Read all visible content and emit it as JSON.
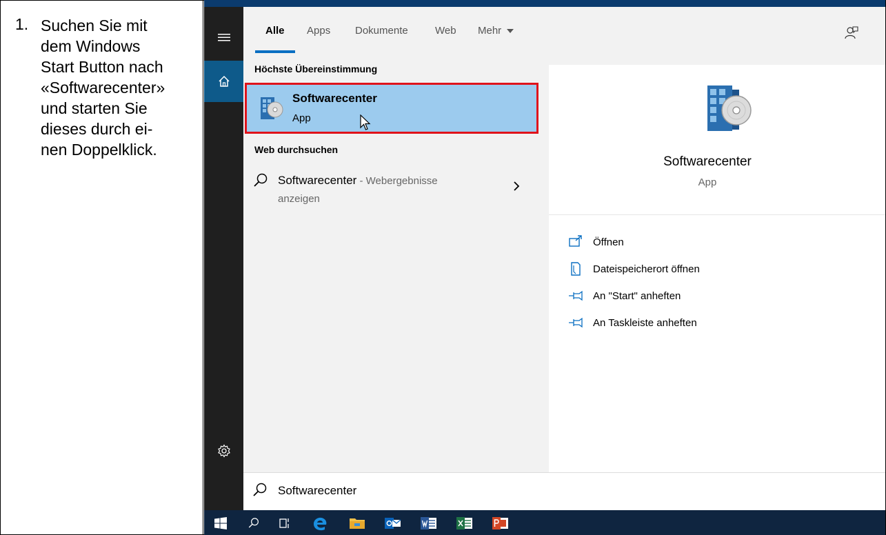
{
  "instruction": {
    "number": "1.",
    "text": "Suchen Sie mit\ndem Windows\nStart Button nach\n«Softwarecenter»\nund starten Sie\ndieses durch ei-\nnen Doppelklick."
  },
  "tabs": [
    {
      "label": "Alle",
      "active": true
    },
    {
      "label": "Apps",
      "active": false
    },
    {
      "label": "Dokumente",
      "active": false
    },
    {
      "label": "Web",
      "active": false
    },
    {
      "label": "Mehr",
      "active": false
    }
  ],
  "results": {
    "best_match_header": "Höchste Übereinstimmung",
    "best_match": {
      "title": "Softwarecenter",
      "subtitle": "App"
    },
    "web_header": "Web durchsuchen",
    "web_result": {
      "term": "Softwarecenter",
      "hint_line1": " - Webergebnisse",
      "hint_line2": "anzeigen"
    }
  },
  "preview": {
    "title": "Softwarecenter",
    "subtitle": "App",
    "actions": [
      {
        "label": "Öffnen",
        "icon": "open-icon"
      },
      {
        "label": "Dateispeicherort öffnen",
        "icon": "file-location-icon"
      },
      {
        "label": "An \"Start\" anheften",
        "icon": "pin-icon"
      },
      {
        "label": "An Taskleiste anheften",
        "icon": "pin-icon"
      }
    ]
  },
  "search": {
    "value": "Softwarecenter"
  },
  "taskbar": {
    "items": [
      "windows-start-icon",
      "search-icon",
      "task-view-icon",
      "edge-icon",
      "file-explorer-icon",
      "outlook-icon",
      "word-icon",
      "excel-icon",
      "powerpoint-icon"
    ]
  },
  "colors": {
    "accent": "#0a6fc2",
    "highlight": "#9ccbee",
    "selection_border": "#e0131b",
    "rail": "#1f1f1f",
    "taskbar": "#0f2540"
  }
}
